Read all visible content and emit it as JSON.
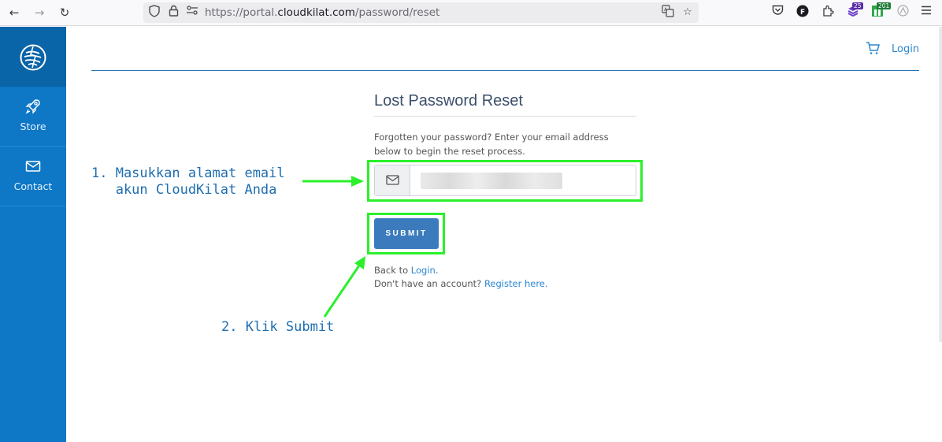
{
  "browser": {
    "url_prefix": "https://portal.",
    "url_domain": "cloudkilat.com",
    "url_path": "/password/reset",
    "ext_badge_purple": "25",
    "ext_badge_green": "201"
  },
  "sidebar": {
    "items": [
      {
        "label": "Store",
        "icon": "rocket-icon"
      },
      {
        "label": "Contact",
        "icon": "envelope-icon"
      }
    ]
  },
  "header": {
    "login_label": "Login"
  },
  "form": {
    "title": "Lost Password Reset",
    "intro": "Forgotten your password? Enter your email address below to begin the reset process.",
    "submit_label": "SUBMIT",
    "back_prefix": "Back to ",
    "back_link": "Login",
    "back_suffix": ".",
    "register_prefix": "Don't have an account? ",
    "register_link": "Register here",
    "register_suffix": "."
  },
  "annotations": {
    "step1_line1": "1. Masukkan alamat email",
    "step1_line2": "   akun CloudKilat Anda",
    "step2": "2. Klik Submit"
  },
  "colors": {
    "sidebar": "#0e77c6",
    "highlight": "#2bf02b",
    "button": "#3b7bbd",
    "link": "#2b87d1"
  }
}
